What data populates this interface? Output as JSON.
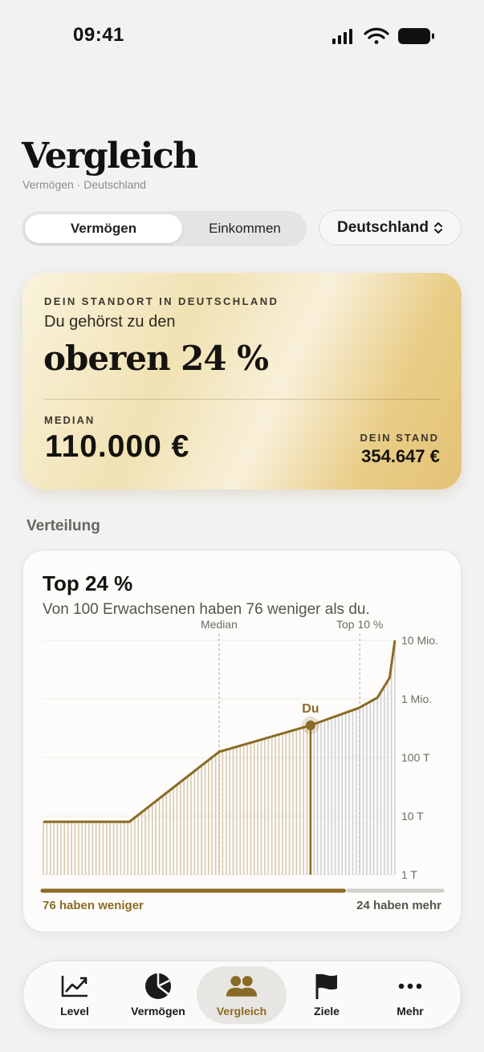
{
  "status_bar": {
    "time": "09:41"
  },
  "page": {
    "title": "Vergleich",
    "subtitle": "Vermögen · Deutschland"
  },
  "segment": {
    "options": [
      "Vermögen",
      "Einkommen"
    ],
    "selected": "Vermögen"
  },
  "country_select": {
    "value": "Deutschland"
  },
  "hero": {
    "eyebrow": "DEIN STANDORT IN DEUTSCHLAND",
    "lead": "Du gehörst zu den",
    "rank": "oberen 24 %",
    "median_label": "MEDIAN",
    "median_value": "110.000 €",
    "stand_label": "DEIN STAND",
    "stand_value": "354.647 €"
  },
  "section": {
    "heading": "Verteilung"
  },
  "distribution": {
    "title": "Top 24 %",
    "subtitle": "Von 100 Erwachsenen haben 76 weniger als du.",
    "legend_left": "76 haben weniger",
    "legend_right": "24 haben mehr",
    "share_less": 0.76
  },
  "chart_data": {
    "type": "area",
    "x_label": "",
    "y_label": "",
    "y_scale": "log",
    "y_ticks": [
      {
        "value": 1000,
        "label": "1 T"
      },
      {
        "value": 10000,
        "label": "10 T"
      },
      {
        "value": 100000,
        "label": "100 T"
      },
      {
        "value": 1000000,
        "label": "1 Mio."
      },
      {
        "value": 10000000,
        "label": "10 Mio."
      }
    ],
    "ylim": [
      1000,
      10000000
    ],
    "xlim": [
      0,
      100
    ],
    "points": [
      {
        "x": 0,
        "y": 8000
      },
      {
        "x": 24.5,
        "y": 8000
      },
      {
        "x": 50,
        "y": 125000
      },
      {
        "x": 76,
        "y": 354647
      },
      {
        "x": 89.7,
        "y": 700000
      },
      {
        "x": 95,
        "y": 1050000
      },
      {
        "x": 98.5,
        "y": 2300000
      },
      {
        "x": 100,
        "y": 10000000
      }
    ],
    "markers": [
      {
        "label": "Median",
        "x": 50
      },
      {
        "label": "Top 10 %",
        "x": 90
      }
    ],
    "highlight": {
      "label": "Du",
      "x": 76,
      "y": 354647
    },
    "colors": {
      "accent": "#8a6a24",
      "bars_less": "#b9a272",
      "bars_more": "#c8c8c8"
    }
  },
  "tabs": [
    {
      "label": "Level",
      "icon": "trend-icon"
    },
    {
      "label": "Vermögen",
      "icon": "pie-chart-icon"
    },
    {
      "label": "Vergleich",
      "icon": "people-icon",
      "active": true
    },
    {
      "label": "Ziele",
      "icon": "flag-icon"
    },
    {
      "label": "Mehr",
      "icon": "more-dots-icon"
    }
  ]
}
